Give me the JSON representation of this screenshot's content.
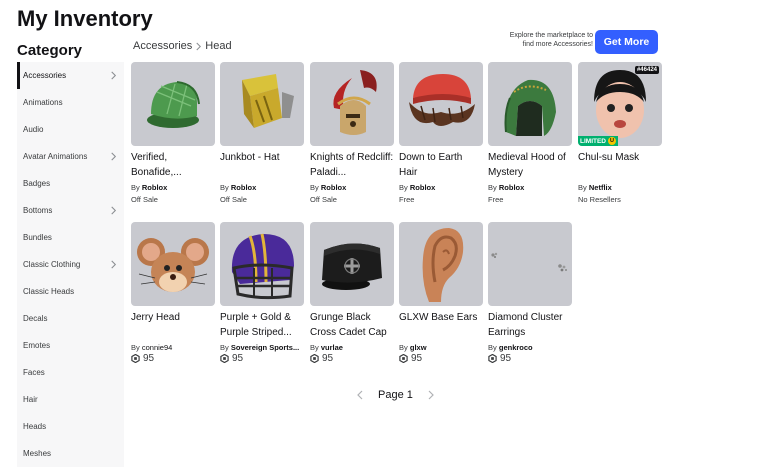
{
  "page": {
    "title": "My Inventory",
    "category_heading": "Category"
  },
  "sidebar": {
    "items": [
      {
        "label": "Accessories",
        "chevron": true,
        "active": true
      },
      {
        "label": "Animations",
        "chevron": false
      },
      {
        "label": "Audio",
        "chevron": false
      },
      {
        "label": "Avatar Animations",
        "chevron": true
      },
      {
        "label": "Badges",
        "chevron": false
      },
      {
        "label": "Bottoms",
        "chevron": true
      },
      {
        "label": "Bundles",
        "chevron": false
      },
      {
        "label": "Classic Clothing",
        "chevron": true
      },
      {
        "label": "Classic Heads",
        "chevron": false
      },
      {
        "label": "Decals",
        "chevron": false
      },
      {
        "label": "Emotes",
        "chevron": false
      },
      {
        "label": "Faces",
        "chevron": false
      },
      {
        "label": "Hair",
        "chevron": false
      },
      {
        "label": "Heads",
        "chevron": false
      },
      {
        "label": "Meshes",
        "chevron": false
      }
    ]
  },
  "breadcrumb": {
    "parent": "Accessories",
    "current": "Head"
  },
  "promo": {
    "text": "Explore the marketplace to find more Accessories!",
    "button": "Get More",
    "button_color": "#335fff"
  },
  "items": [
    {
      "name": "Verified, Bonafide,...",
      "by": "By",
      "creator": "Roblox",
      "status": "Off Sale",
      "icon": "green-plaid-cap-icon"
    },
    {
      "name": "Junkbot - Hat",
      "by": "By",
      "creator": "Roblox",
      "status": "Off Sale",
      "icon": "junkbot-hat-icon"
    },
    {
      "name": "Knights of Redcliff: Paladi...",
      "by": "By",
      "creator": "Roblox",
      "status": "Off Sale",
      "icon": "paladin-helmet-icon"
    },
    {
      "name": "Down to Earth Hair",
      "by": "By",
      "creator": "Roblox",
      "status": "Free",
      "icon": "brown-hair-beanie-icon"
    },
    {
      "name": "Medieval Hood of Mystery",
      "by": "By",
      "creator": "Roblox",
      "status": "Free",
      "icon": "green-hood-icon"
    },
    {
      "name": "Chul-su Mask",
      "by": "By",
      "creator": "Netflix",
      "status": "No Resellers",
      "icon": "chulsu-mask-icon",
      "serial": "#46424",
      "limited": "LIMITED",
      "limited_u": "U"
    },
    {
      "name": "Jerry Head",
      "by": "By",
      "creator": "connie94",
      "price": "95",
      "icon": "jerry-mouse-head-icon"
    },
    {
      "name": "Purple + Gold & Purple Striped...",
      "by": "By",
      "creator": "Sovereign Sports...",
      "price": "95",
      "icon": "football-helmet-icon"
    },
    {
      "name": "Grunge Black Cross Cadet Cap",
      "by": "By",
      "creator": "vurlae",
      "price": "95",
      "icon": "black-cadet-cap-icon"
    },
    {
      "name": "GLXW Base Ears",
      "by": "By",
      "creator": "glxw",
      "price": "95",
      "icon": "ear-icon"
    },
    {
      "name": "Diamond Cluster Earrings",
      "by": "By",
      "creator": "genkroco",
      "price": "95",
      "icon": "diamond-earrings-icon"
    }
  ],
  "pagination": {
    "label": "Page 1"
  },
  "colors": {
    "accent": "#335fff",
    "limited": "#00b06f",
    "thumb_bg": "#c8c9cf"
  }
}
